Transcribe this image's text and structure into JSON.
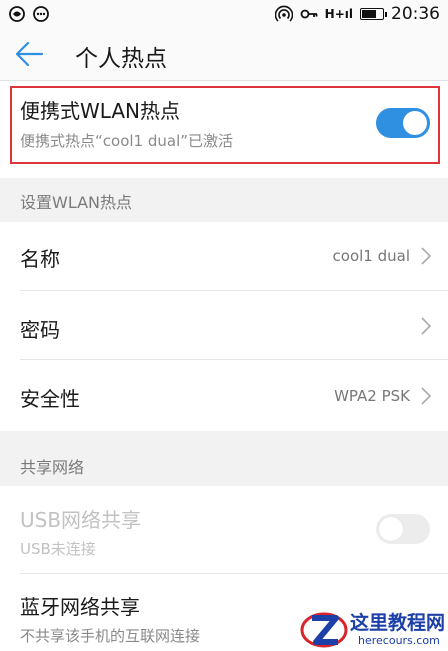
{
  "status_bar": {
    "left_icons": [
      "notification-icon",
      "chat-icon"
    ],
    "right_icons": [
      "hotspot-icon",
      "key-icon",
      "signal-icon"
    ],
    "signal_label": "H+ıl",
    "battery_level": 0.75,
    "time": "20:36"
  },
  "app_bar": {
    "title": "个人热点"
  },
  "hotspot": {
    "label": "便携式WLAN热点",
    "status": "便携式热点“cool1 dual”已激活",
    "enabled": true
  },
  "setup_section": {
    "header": "设置WLAN热点",
    "name": {
      "label": "名称",
      "value": "cool1 dual"
    },
    "password": {
      "label": "密码"
    },
    "security": {
      "label": "安全性",
      "value": "WPA2 PSK"
    }
  },
  "share_section": {
    "header": "共享网络",
    "usb": {
      "label": "USB网络共享",
      "status": "USB未连接",
      "enabled": false
    },
    "bluetooth": {
      "label": "蓝牙网络共享",
      "status": "不共享该手机的互联网连接"
    }
  },
  "watermark": {
    "brand": "这里教程网",
    "url": "herecours.com"
  },
  "colors": {
    "accent": "#2f8fe0",
    "highlight": "#e0343b",
    "section_bg": "#f2f2f2"
  }
}
